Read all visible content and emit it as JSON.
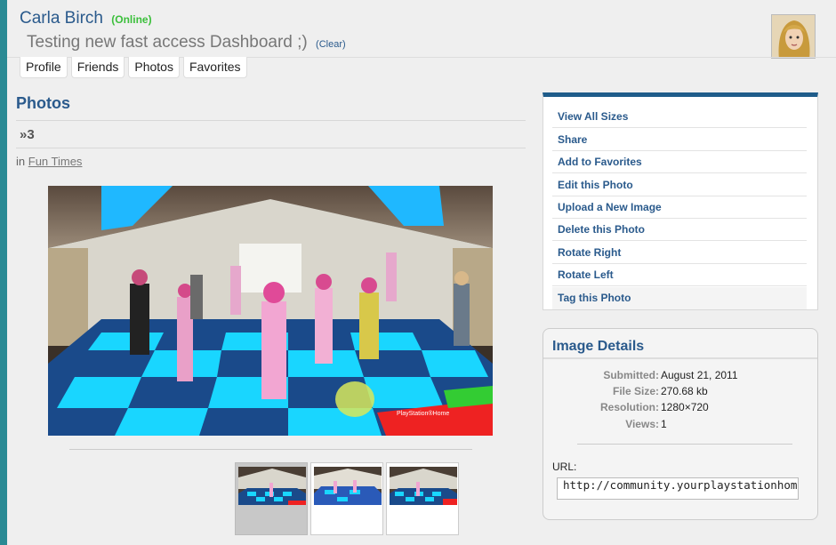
{
  "header": {
    "name": "Carla Birch",
    "status": "(Online)",
    "status_message": "Testing new fast access Dashboard ;)",
    "clear_label": "(Clear)"
  },
  "tabs": [
    {
      "label": "Profile"
    },
    {
      "label": "Friends"
    },
    {
      "label": "Photos"
    },
    {
      "label": "Favorites"
    }
  ],
  "main": {
    "title": "Photos",
    "photo_title": "»3",
    "in_prefix": "in",
    "album": "Fun Times",
    "watermark": "PlayStation®Home"
  },
  "actions": [
    {
      "label": "View All Sizes"
    },
    {
      "label": "Share"
    },
    {
      "label": "Add to Favorites"
    },
    {
      "label": "Edit this Photo"
    },
    {
      "label": "Upload a New Image"
    },
    {
      "label": "Delete this Photo"
    },
    {
      "label": "Rotate Right"
    },
    {
      "label": "Rotate Left"
    },
    {
      "label": "Tag this Photo"
    }
  ],
  "details": {
    "title": "Image Details",
    "rows": [
      {
        "label": "Submitted:",
        "value": "August 21, 2011"
      },
      {
        "label": "File Size:",
        "value": "270.68 kb"
      },
      {
        "label": "Resolution:",
        "value": "1280×720"
      },
      {
        "label": "Views:",
        "value": "1"
      }
    ],
    "url_label": "URL:",
    "url_value": "http://community.yourplaystationhome."
  },
  "colors": {
    "accent": "#1f5c8a",
    "link": "#2a5a8c",
    "online": "#3bbf3b",
    "page_bg": "#efefef",
    "frame": "#2a8a94"
  }
}
